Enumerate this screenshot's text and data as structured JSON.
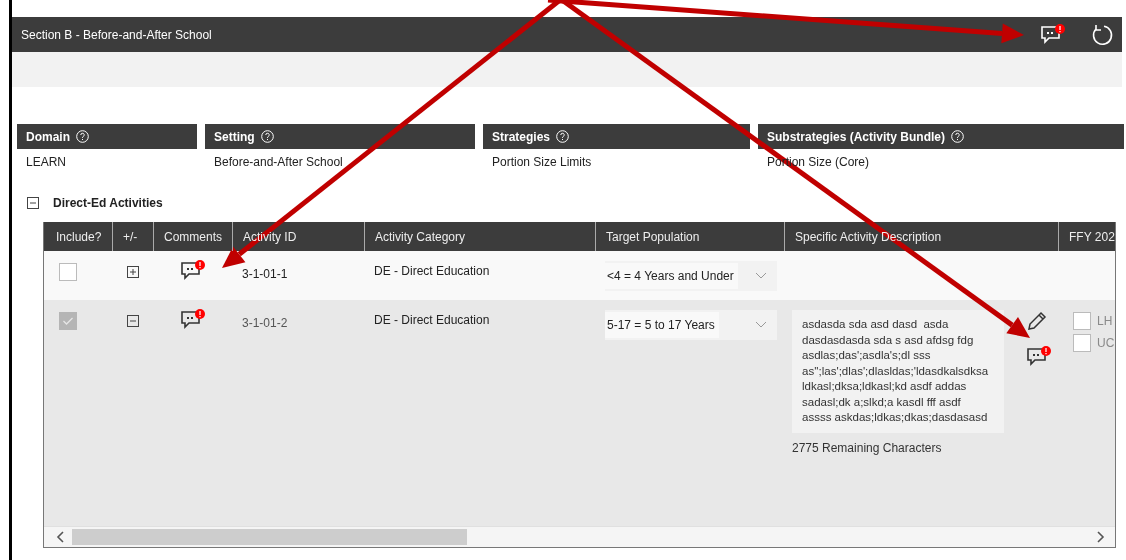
{
  "section": {
    "title": "Section B - Before-and-After School",
    "comment_alert": true
  },
  "info": [
    {
      "label": "Domain",
      "value": "LEARN"
    },
    {
      "label": "Setting",
      "value": "Before-and-After School"
    },
    {
      "label": "Strategies",
      "value": "Portion Size Limits"
    },
    {
      "label": "Substrategies (Activity Bundle)",
      "value": "Portion Size (Core)"
    }
  ],
  "group": {
    "title": "Direct-Ed Activities",
    "expanded": true
  },
  "table": {
    "columns": [
      "Include?",
      "+/-",
      "Comments",
      "Activity ID",
      "Activity Category",
      "Target Population",
      "Specific Activity Description",
      "FFY 202"
    ],
    "rows": [
      {
        "included": false,
        "disabled": false,
        "expanded": false,
        "comment_alert": true,
        "activity_id": "3-1-01-1",
        "category": "DE - Direct Education",
        "target_population": "<4 = 4 Years and Under"
      },
      {
        "included": true,
        "disabled": true,
        "expanded": true,
        "comment_alert": true,
        "activity_id": "3-1-01-2",
        "category": "DE - Direct Education",
        "target_population": "5-17 = 5 to 17 Years",
        "description": "asdasda sda asd dasd  asda\ndasdasdasda sda s asd afdsg fdg\nasdlas;das';asdla's;dl sss\nas'';las';dlas';dlasldas;'ldasdkalsdksa\nldkasl;dksa;ldkasl;kd asdf addas\nsadasl;dk a;slkd;a kasdl fff asdf\nassss askdas;ldkas;dkas;dasdasasd",
        "remaining": "2775 Remaining Characters",
        "description_comment_alert": true,
        "options": [
          {
            "label": "LH",
            "checked": false
          },
          {
            "label": "UC",
            "checked": false
          }
        ]
      }
    ]
  }
}
